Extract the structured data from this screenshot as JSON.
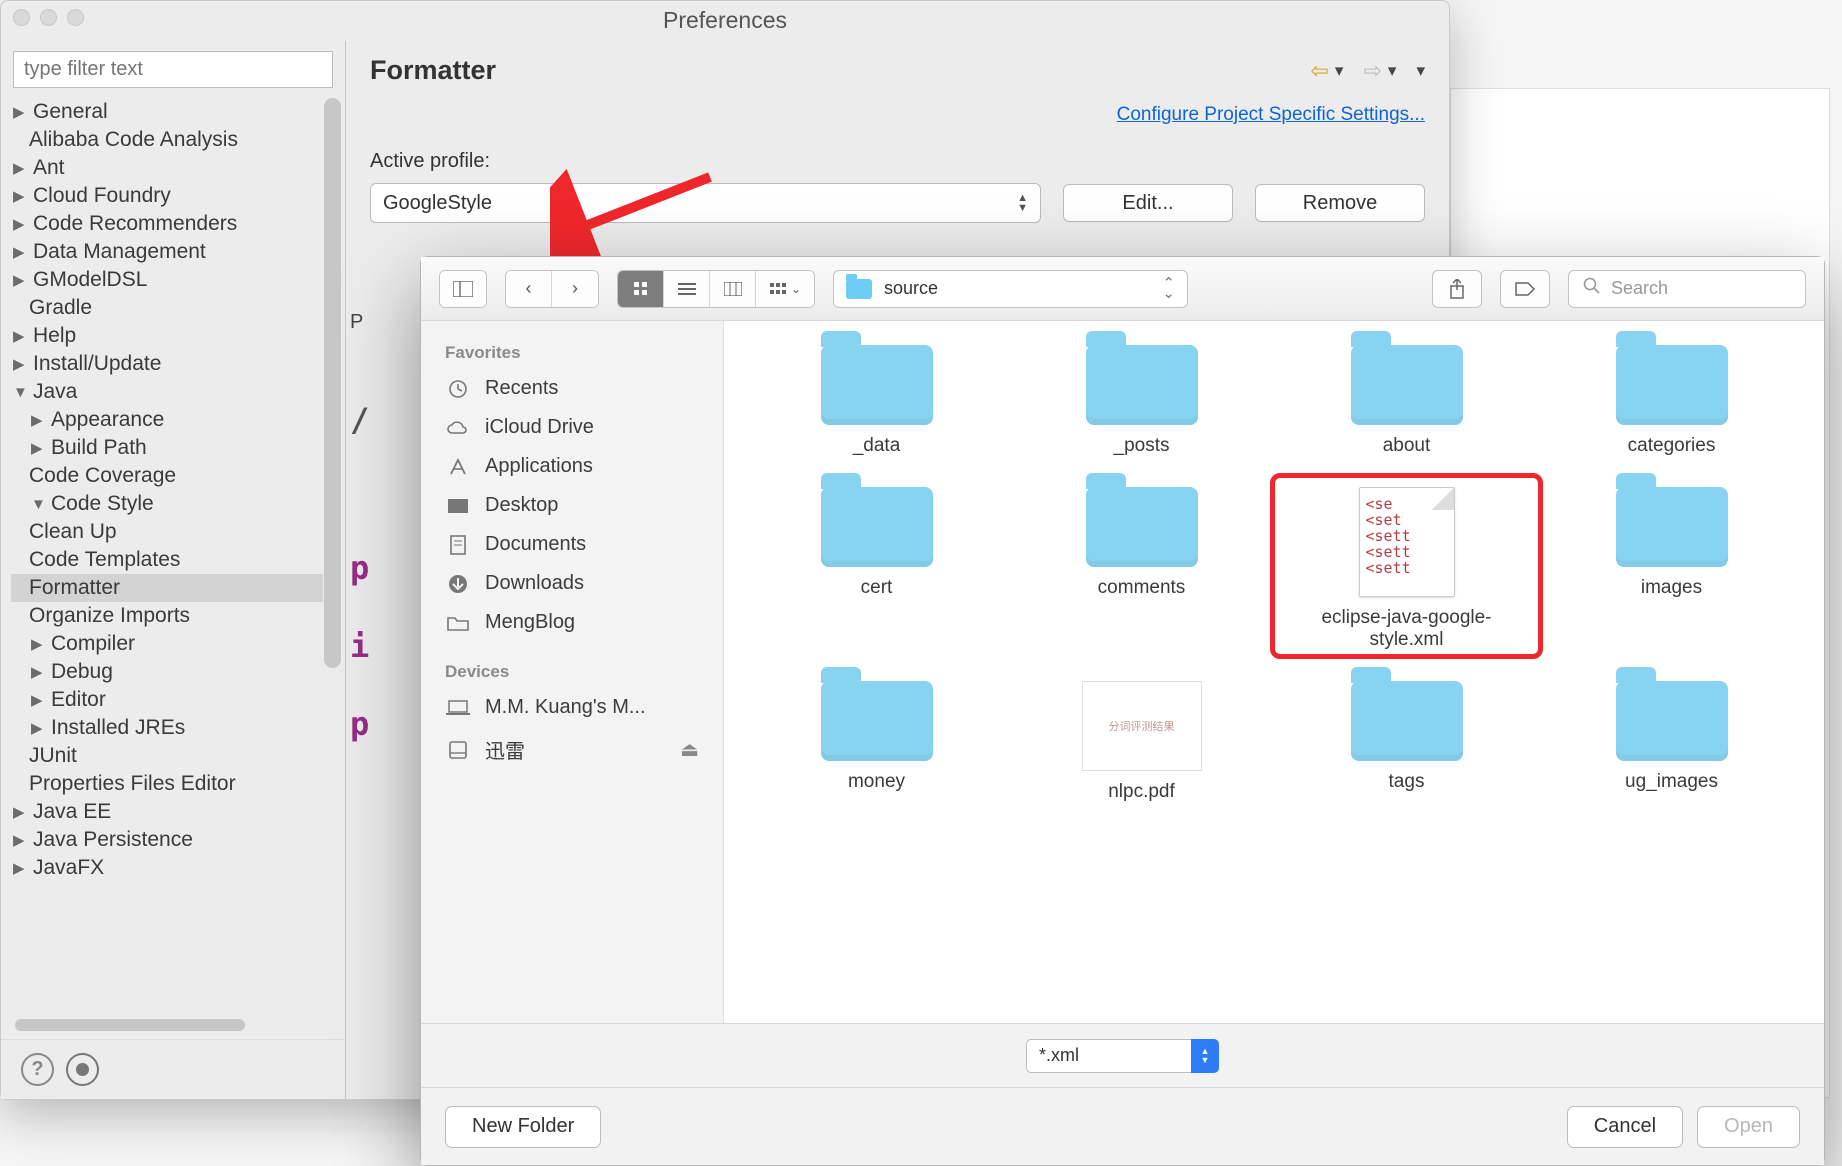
{
  "window": {
    "title": "Preferences"
  },
  "sidebar": {
    "filter_placeholder": "type filter text",
    "items": [
      {
        "label": "General",
        "level": 0,
        "arrow": "right"
      },
      {
        "label": "Alibaba Code Analysis",
        "level": 0,
        "arrow": "none"
      },
      {
        "label": "Ant",
        "level": 0,
        "arrow": "right"
      },
      {
        "label": "Cloud Foundry",
        "level": 0,
        "arrow": "right"
      },
      {
        "label": "Code Recommenders",
        "level": 0,
        "arrow": "right"
      },
      {
        "label": "Data Management",
        "level": 0,
        "arrow": "right"
      },
      {
        "label": "GModelDSL",
        "level": 0,
        "arrow": "right"
      },
      {
        "label": "Gradle",
        "level": 0,
        "arrow": "none"
      },
      {
        "label": "Help",
        "level": 0,
        "arrow": "right"
      },
      {
        "label": "Install/Update",
        "level": 0,
        "arrow": "right"
      },
      {
        "label": "Java",
        "level": 0,
        "arrow": "down"
      },
      {
        "label": "Appearance",
        "level": 1,
        "arrow": "right"
      },
      {
        "label": "Build Path",
        "level": 1,
        "arrow": "right"
      },
      {
        "label": "Code Coverage",
        "level": 1,
        "arrow": "none"
      },
      {
        "label": "Code Style",
        "level": 1,
        "arrow": "down"
      },
      {
        "label": "Clean Up",
        "level": 2,
        "arrow": "none"
      },
      {
        "label": "Code Templates",
        "level": 2,
        "arrow": "none"
      },
      {
        "label": "Formatter",
        "level": 2,
        "arrow": "none",
        "selected": true
      },
      {
        "label": "Organize Imports",
        "level": 2,
        "arrow": "none"
      },
      {
        "label": "Compiler",
        "level": 1,
        "arrow": "right"
      },
      {
        "label": "Debug",
        "level": 1,
        "arrow": "right"
      },
      {
        "label": "Editor",
        "level": 1,
        "arrow": "right"
      },
      {
        "label": "Installed JREs",
        "level": 1,
        "arrow": "right"
      },
      {
        "label": "JUnit",
        "level": 1,
        "arrow": "none"
      },
      {
        "label": "Properties Files Editor",
        "level": 1,
        "arrow": "none"
      },
      {
        "label": "Java EE",
        "level": 0,
        "arrow": "right"
      },
      {
        "label": "Java Persistence",
        "level": 0,
        "arrow": "right"
      },
      {
        "label": "JavaFX",
        "level": 0,
        "arrow": "right"
      }
    ]
  },
  "pane": {
    "title": "Formatter",
    "config_link": "Configure Project Specific Settings...",
    "profile_label": "Active profile:",
    "profile_value": "GoogleStyle",
    "edit_label": "Edit...",
    "remove_label": "Remove",
    "preview_hint_1": "P",
    "preview_hint_2": "/",
    "preview_hint_3": "p",
    "preview_hint_4": "i",
    "preview_hint_5": "p"
  },
  "finder": {
    "path_label": "source",
    "search_placeholder": "Search",
    "sidebar": {
      "cat1": "Favorites",
      "items1": [
        {
          "label": "Recents",
          "icon": "clock"
        },
        {
          "label": "iCloud Drive",
          "icon": "cloud"
        },
        {
          "label": "Applications",
          "icon": "apps"
        },
        {
          "label": "Desktop",
          "icon": "desktop"
        },
        {
          "label": "Documents",
          "icon": "docs"
        },
        {
          "label": "Downloads",
          "icon": "down"
        },
        {
          "label": "MengBlog",
          "icon": "folder"
        }
      ],
      "cat2": "Devices",
      "items2": [
        {
          "label": "M.M. Kuang's M...",
          "icon": "laptop"
        },
        {
          "label": "迅雷",
          "icon": "disk",
          "eject": true
        }
      ]
    },
    "files": [
      {
        "name": "_data",
        "type": "folder"
      },
      {
        "name": "_posts",
        "type": "folder"
      },
      {
        "name": "about",
        "type": "folder"
      },
      {
        "name": "categories",
        "type": "folder"
      },
      {
        "name": "cert",
        "type": "folder"
      },
      {
        "name": "comments",
        "type": "folder"
      },
      {
        "name": "eclipse-java-google-style.xml",
        "type": "xml",
        "highlight": true
      },
      {
        "name": "images",
        "type": "folder"
      },
      {
        "name": "money",
        "type": "folder"
      },
      {
        "name": "nlpc.pdf",
        "type": "pdf"
      },
      {
        "name": "tags",
        "type": "folder"
      },
      {
        "name": "ug_images",
        "type": "folder"
      }
    ],
    "filter_value": "*.xml",
    "new_folder_label": "New Folder",
    "cancel_label": "Cancel",
    "open_label": "Open",
    "xml_preview_lines": "<se\n<set\n<sett\n<sett\n<sett",
    "pdf_preview_text": "分词评测结果"
  }
}
